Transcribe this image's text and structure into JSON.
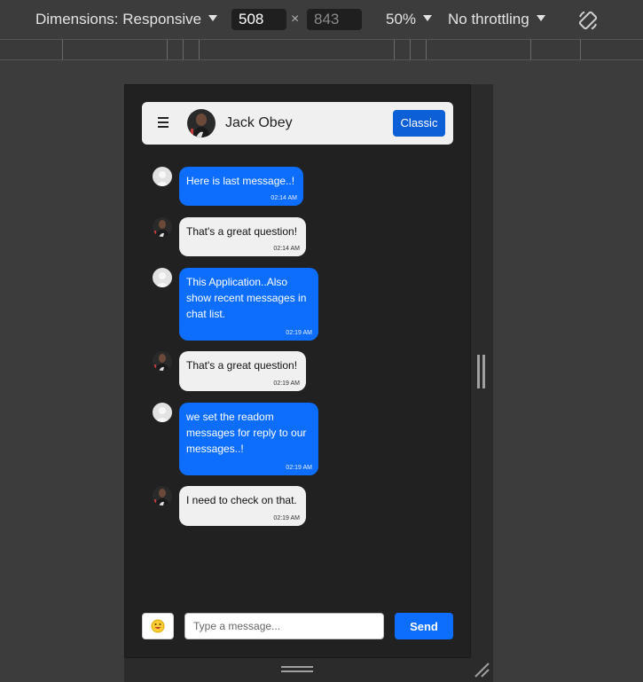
{
  "devtools": {
    "dimensions_label": "Dimensions: Responsive",
    "width": "508",
    "height": "843",
    "times": "×",
    "zoom": "50%",
    "throttling": "No throttling",
    "icons": [
      "chevron-down-icon",
      "rotate-icon"
    ]
  },
  "chat": {
    "header": {
      "menu_icon": "hamburger-menu-icon",
      "contact_name": "Jack Obey",
      "mode_button": "Classic"
    },
    "messages": [
      {
        "direction": "sent",
        "text": "Here is last message..!",
        "time": "02:14 AM"
      },
      {
        "direction": "received",
        "text": "That's a great question!",
        "time": "02:14 AM"
      },
      {
        "direction": "sent",
        "text": "This Application..Also show recent messages in chat list.",
        "time": "02:19 AM"
      },
      {
        "direction": "received",
        "text": "That's a great question!",
        "time": "02:19 AM"
      },
      {
        "direction": "sent",
        "text": "we set the readom messages for reply to our messages..!",
        "time": "02:19 AM"
      },
      {
        "direction": "received",
        "text": "I need to check on that.",
        "time": "02:19 AM"
      }
    ],
    "composer": {
      "emoji_icon": "emoji-face-icon",
      "placeholder": "Type a message...",
      "send_label": "Send"
    }
  },
  "colors": {
    "sent_bubble": "#0d6efd",
    "received_bubble": "#f0f0f0",
    "classic_button": "#0d5fd8",
    "chat_background": "#212121"
  }
}
